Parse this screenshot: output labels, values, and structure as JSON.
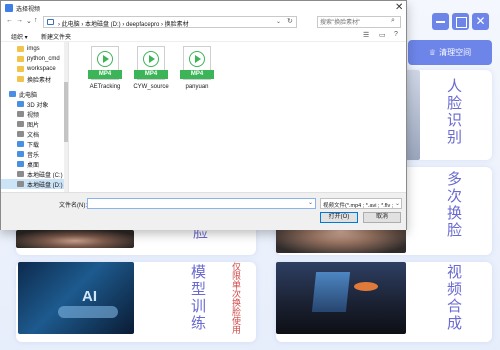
{
  "app": {
    "window_controls": {
      "minimize": "",
      "maximize": "",
      "close": "✕"
    },
    "clean_button": {
      "icon": "broom-icon",
      "label": "清理空间"
    },
    "cards": [
      {
        "title": "人脸识别"
      },
      {
        "title": "多次换脸"
      },
      {
        "title": "模型训练",
        "note": "仅限单次换脸使用"
      },
      {
        "title": "视频合成"
      }
    ],
    "left_partial_text": "脸",
    "photo_ai_text": "AI"
  },
  "dialog": {
    "title": "选择视频",
    "close": "✕",
    "nav": {
      "back": "←",
      "forward": "→",
      "dropdown": "⌄",
      "up": "↑"
    },
    "breadcrumbs": [
      "此电脑",
      "本地磁盘 (D:)",
      "deepfacepro",
      "换脸素材"
    ],
    "breadcrumb_text": "›  此电脑  ›  本地磁盘 (D:)  ›  deepfacepro  ›  换脸素材",
    "search_placeholder": "搜索\"换脸素材\"",
    "toolbar": {
      "organize": "组织 ▾",
      "new_folder": "新建文件夹"
    },
    "nav_items": [
      {
        "label": "imgs",
        "icon": "folder-icon"
      },
      {
        "label": "python_cmd",
        "icon": "folder-icon"
      },
      {
        "label": "workspace",
        "icon": "folder-icon"
      },
      {
        "label": "换脸素材",
        "icon": "folder-icon"
      },
      {
        "label": "此电脑",
        "icon": "computer-icon"
      },
      {
        "label": "3D 对象",
        "icon": "cube-icon"
      },
      {
        "label": "视频",
        "icon": "video-icon"
      },
      {
        "label": "图片",
        "icon": "picture-icon"
      },
      {
        "label": "文档",
        "icon": "document-icon"
      },
      {
        "label": "下载",
        "icon": "download-icon"
      },
      {
        "label": "音乐",
        "icon": "music-icon"
      },
      {
        "label": "桌面",
        "icon": "desktop-icon"
      },
      {
        "label": "本地磁盘 (C:)",
        "icon": "drive-icon"
      },
      {
        "label": "本地磁盘 (D:)",
        "icon": "drive-icon"
      }
    ],
    "files": [
      {
        "tag": "MP4",
        "name": "AETracking"
      },
      {
        "tag": "MP4",
        "name": "CYW_source"
      },
      {
        "tag": "MP4",
        "name": "panyuan"
      }
    ],
    "file_name_label": "文件名(N):",
    "file_name_value": "",
    "file_type": "视频文件(*.mp4 ; *.avi ; *.flv ;",
    "open_button": "打开(O)",
    "cancel_button": "取消"
  },
  "colors": {
    "accent": "#6d84e8",
    "mp4_green": "#3bb557",
    "title_purple": "#6a6ad0",
    "note_red": "#d14a4a"
  }
}
